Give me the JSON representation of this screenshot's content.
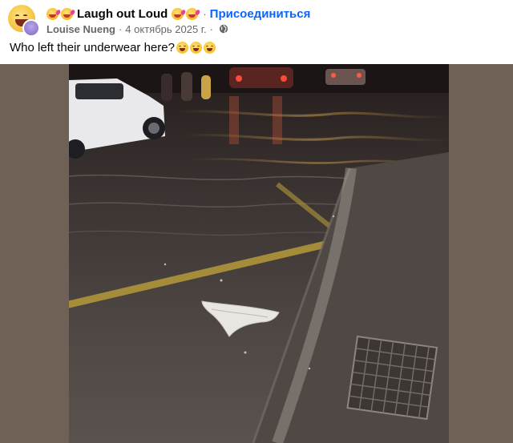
{
  "post": {
    "group_name": "Laugh out Loud",
    "join_label": "Присоединиться",
    "author": "Louise Nueng",
    "date": "4 октябрь 2025 г.",
    "caption": "Who left their underwear here?",
    "caption_emoji_count": 3,
    "separator": "·"
  },
  "icons": {
    "avatar": "laughing-face-avatar",
    "title_emoji": "zany-face-emoji",
    "privacy": "globe-icon",
    "caption_emoji": "grinning-face-emoji"
  },
  "colors": {
    "link": "#0866ff",
    "secondary_text": "#65676b",
    "primary_text": "#050505",
    "media_backdrop": "#6f6156"
  }
}
